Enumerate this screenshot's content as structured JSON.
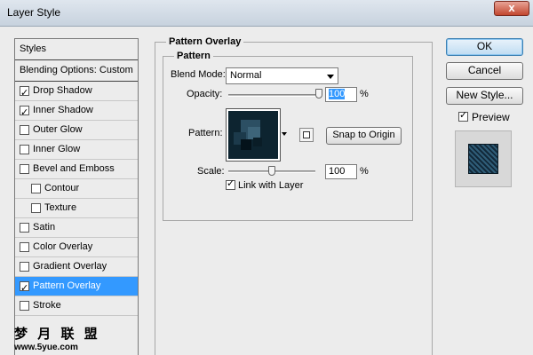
{
  "window": {
    "title": "Layer Style",
    "close_glyph": "x"
  },
  "styles_panel": {
    "header": "Styles",
    "blending_options": "Blending Options: Custom",
    "items": [
      {
        "label": "Drop Shadow",
        "checked": true
      },
      {
        "label": "Inner Shadow",
        "checked": true
      },
      {
        "label": "Outer Glow",
        "checked": false
      },
      {
        "label": "Inner Glow",
        "checked": false
      },
      {
        "label": "Bevel and Emboss",
        "checked": false
      },
      {
        "label": "Contour",
        "checked": false
      },
      {
        "label": "Texture",
        "checked": false
      },
      {
        "label": "Satin",
        "checked": false
      },
      {
        "label": "Color Overlay",
        "checked": false
      },
      {
        "label": "Gradient Overlay",
        "checked": false
      },
      {
        "label": "Pattern Overlay",
        "checked": true
      },
      {
        "label": "Stroke",
        "checked": false
      }
    ],
    "selected": "Pattern Overlay"
  },
  "pattern_overlay": {
    "section_title": "Pattern Overlay",
    "group_title": "Pattern",
    "blend_mode_label": "Blend Mode:",
    "blend_mode_value": "Normal",
    "opacity_label": "Opacity:",
    "opacity_value": "100",
    "opacity_unit": "%",
    "opacity_fraction": 1.0,
    "pattern_label": "Pattern:",
    "snap_button": "Snap to Origin",
    "scale_label": "Scale:",
    "scale_value": "100",
    "scale_unit": "%",
    "scale_fraction": 0.5,
    "link_label": "Link with Layer",
    "link_checked": true
  },
  "actions": {
    "ok": "OK",
    "cancel": "Cancel",
    "new_style": "New Style...",
    "preview_label": "Preview",
    "preview_checked": true
  },
  "watermark": {
    "line1": "梦 月 联 盟",
    "line2": "www.5yue.com"
  },
  "colors": {
    "selection": "#3399ff",
    "pattern_dark": "#0d2430"
  }
}
